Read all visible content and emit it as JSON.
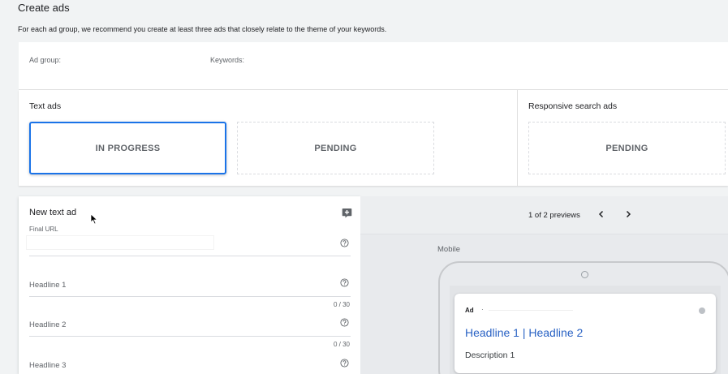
{
  "header": {
    "title": "Create ads",
    "subtitle": "For each ad group, we recommend you create at least three ads that closely relate to the theme of your keywords."
  },
  "ad_group_bar": {
    "ad_group_label": "Ad group:",
    "keywords_label": "Keywords:"
  },
  "text_ads": {
    "title": "Text ads",
    "boxes": [
      {
        "label": "IN PROGRESS"
      },
      {
        "label": "PENDING"
      }
    ]
  },
  "responsive_ads": {
    "title": "Responsive search ads",
    "boxes": [
      {
        "label": "PENDING"
      }
    ]
  },
  "form": {
    "title": "New text ad",
    "final_url_label": "Final URL",
    "final_url_value": "",
    "fields": [
      {
        "label": "Headline 1",
        "counter": "0 / 30"
      },
      {
        "label": "Headline 2",
        "counter": "0 / 30"
      },
      {
        "label": "Headline 3"
      }
    ]
  },
  "preview": {
    "count": "1 of 2 previews",
    "device_label": "Mobile",
    "ad_badge": "Ad",
    "ad_separator": "·",
    "headline": "Headline 1 | Headline 2",
    "description": "Description 1"
  },
  "colors": {
    "accent": "#1a73e8",
    "headline_link": "#2962c4"
  }
}
